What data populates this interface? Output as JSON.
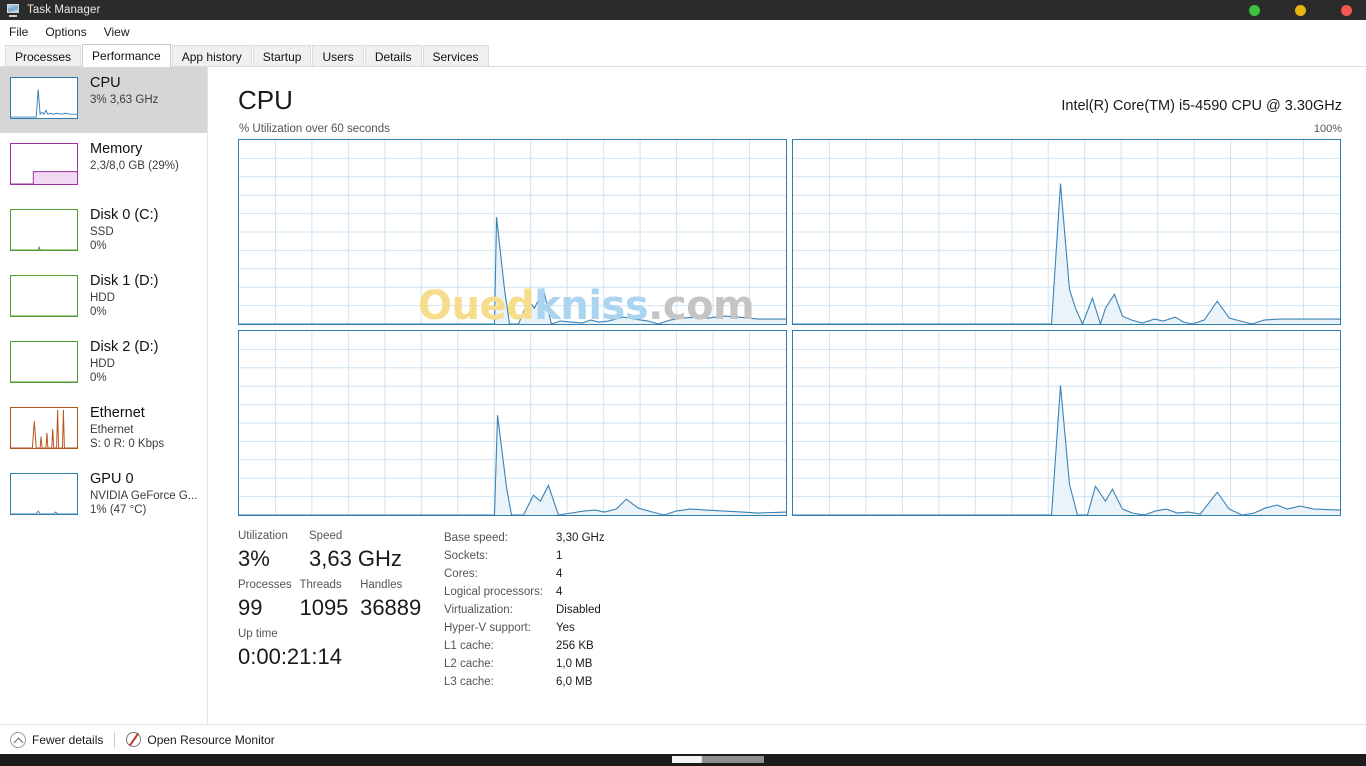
{
  "window": {
    "title": "Task Manager",
    "icon": "task-manager-icon",
    "buttons": [
      {
        "name": "minimize-button",
        "color": "#3fc23f"
      },
      {
        "name": "maximize-button",
        "color": "#e8b512"
      },
      {
        "name": "close-button",
        "color": "#f6564f"
      }
    ]
  },
  "menubar": {
    "items": [
      {
        "label": "File"
      },
      {
        "label": "Options"
      },
      {
        "label": "View"
      }
    ]
  },
  "tabs": {
    "active": "Performance",
    "items": [
      {
        "label": "Processes"
      },
      {
        "label": "Performance"
      },
      {
        "label": "App history"
      },
      {
        "label": "Startup"
      },
      {
        "label": "Users"
      },
      {
        "label": "Details"
      },
      {
        "label": "Services"
      }
    ]
  },
  "sidebar": {
    "items": [
      {
        "name": "cpu",
        "title": "CPU",
        "sub1": "3%  3,63 GHz",
        "sub2": "",
        "selected": true,
        "accent": "#2e7cb0",
        "thumb": "blue"
      },
      {
        "name": "memory",
        "title": "Memory",
        "sub1": "2,3/8,0 GB (29%)",
        "sub2": "",
        "selected": false,
        "accent": "#9c2f9c",
        "thumb": "purple"
      },
      {
        "name": "disk-0",
        "title": "Disk 0 (C:)",
        "sub1": "SSD",
        "sub2": "0%",
        "selected": false,
        "accent": "#4f9c2f",
        "thumb": "green"
      },
      {
        "name": "disk-1",
        "title": "Disk 1 (D:)",
        "sub1": "HDD",
        "sub2": "0%",
        "selected": false,
        "accent": "#4f9c2f",
        "thumb": "green"
      },
      {
        "name": "disk-2",
        "title": "Disk 2 (D:)",
        "sub1": "HDD",
        "sub2": "0%",
        "selected": false,
        "accent": "#4f9c2f",
        "thumb": "green"
      },
      {
        "name": "ethernet",
        "title": "Ethernet",
        "sub1": "Ethernet",
        "sub2": "S: 0 R: 0 Kbps",
        "selected": false,
        "accent": "#b5541c",
        "thumb": "orange"
      },
      {
        "name": "gpu-0",
        "title": "GPU 0",
        "sub1": "NVIDIA GeForce G...",
        "sub2": "1% (47 °C)",
        "selected": false,
        "accent": "#2e7cb0",
        "thumb": "blue"
      }
    ]
  },
  "main": {
    "title": "CPU",
    "cpu_name": "Intel(R) Core(TM) i5-4590 CPU @ 3.30GHz",
    "graph_label": "% Utilization over 60 seconds",
    "graph_max": "100%",
    "watermark": {
      "part1": "Oued",
      "part2": "kniss",
      "part3": ".com"
    }
  },
  "stats": {
    "left": [
      {
        "label": "Utilization",
        "value": "3%"
      },
      {
        "label": "Speed",
        "value": "3,63 GHz"
      },
      {
        "label": "Processes",
        "value": "99"
      },
      {
        "label": "Threads",
        "value": "1095"
      },
      {
        "label": "Handles",
        "value": "36889"
      },
      {
        "label": "Up time",
        "value": "0:00:21:14"
      }
    ],
    "right": [
      {
        "key": "Base speed:",
        "value": "3,30 GHz"
      },
      {
        "key": "Sockets:",
        "value": "1"
      },
      {
        "key": "Cores:",
        "value": "4"
      },
      {
        "key": "Logical processors:",
        "value": "4"
      },
      {
        "key": "Virtualization:",
        "value": "Disabled"
      },
      {
        "key": "Hyper-V support:",
        "value": "Yes"
      },
      {
        "key": "L1 cache:",
        "value": "256 KB"
      },
      {
        "key": "L2 cache:",
        "value": "1,0 MB"
      },
      {
        "key": "L3 cache:",
        "value": "6,0 MB"
      }
    ]
  },
  "statusbar": {
    "fewer_details": "Fewer details",
    "open_resource_monitor": "Open Resource Monitor"
  },
  "chart_data": {
    "type": "area",
    "title": "% Utilization over 60 seconds",
    "ylabel": "% Utilization",
    "xlabel": "60 seconds",
    "ylim": [
      0,
      100
    ],
    "grid": true,
    "legend": "none",
    "note": "Four per-logical-processor CPU utilization graphs",
    "series": [
      {
        "name": "CPU 0",
        "values": [
          0,
          0,
          0,
          0,
          0,
          0,
          0,
          0,
          0,
          0,
          0,
          0,
          0,
          0,
          0,
          0,
          0,
          0,
          0,
          0,
          0,
          0,
          0,
          0,
          0,
          0,
          0,
          0,
          0,
          0,
          0,
          0,
          0,
          0,
          0,
          0,
          0,
          0,
          0,
          0,
          0,
          0,
          0,
          0,
          0,
          0,
          0,
          0,
          0,
          0,
          0,
          0,
          58,
          38,
          2,
          0,
          8,
          14,
          5,
          2,
          18,
          6,
          4,
          4,
          3,
          4,
          3,
          5,
          4,
          4,
          3,
          6,
          9,
          10,
          7,
          4,
          2,
          1,
          2,
          5,
          7,
          5,
          4,
          6,
          8,
          8,
          6,
          4
        ]
      },
      {
        "name": "CPU 1",
        "values": [
          0,
          0,
          0,
          0,
          0,
          0,
          0,
          0,
          0,
          0,
          0,
          0,
          0,
          0,
          0,
          0,
          0,
          0,
          0,
          0,
          0,
          0,
          0,
          0,
          0,
          0,
          0,
          0,
          0,
          0,
          0,
          0,
          0,
          0,
          0,
          0,
          0,
          0,
          0,
          0,
          0,
          0,
          0,
          0,
          0,
          0,
          0,
          0,
          0,
          0,
          0,
          0,
          78,
          40,
          4,
          2,
          9,
          22,
          7,
          15,
          4,
          3,
          4,
          5,
          6,
          3,
          8,
          6,
          4,
          7,
          5,
          3,
          6,
          14,
          12,
          7,
          4,
          2,
          4,
          5,
          5,
          6,
          6,
          6,
          6,
          6,
          6,
          5
        ]
      },
      {
        "name": "CPU 2",
        "values": [
          0,
          0,
          0,
          0,
          0,
          0,
          0,
          0,
          0,
          0,
          0,
          0,
          0,
          0,
          0,
          0,
          0,
          0,
          0,
          0,
          0,
          0,
          0,
          0,
          0,
          0,
          0,
          0,
          0,
          0,
          0,
          0,
          0,
          0,
          0,
          0,
          0,
          0,
          0,
          0,
          0,
          0,
          0,
          0,
          0,
          0,
          0,
          0,
          0,
          0,
          0,
          0,
          56,
          36,
          2,
          0,
          7,
          12,
          4,
          14,
          2,
          2,
          3,
          4,
          5,
          3,
          4,
          5,
          4,
          9,
          7,
          4,
          2,
          1,
          3,
          5,
          6,
          5,
          4,
          5,
          4,
          4,
          3,
          3,
          4,
          3,
          2,
          2
        ]
      },
      {
        "name": "CPU 3",
        "values": [
          0,
          0,
          0,
          0,
          0,
          0,
          0,
          0,
          0,
          0,
          0,
          0,
          0,
          0,
          0,
          0,
          0,
          0,
          0,
          0,
          0,
          0,
          0,
          0,
          0,
          0,
          0,
          0,
          0,
          0,
          0,
          0,
          0,
          0,
          0,
          0,
          0,
          0,
          0,
          0,
          0,
          0,
          0,
          0,
          0,
          0,
          0,
          0,
          0,
          0,
          0,
          0,
          72,
          35,
          2,
          0,
          14,
          13,
          5,
          9,
          4,
          2,
          4,
          5,
          3,
          5,
          4,
          3,
          5,
          4,
          6,
          12,
          10,
          5,
          2,
          1,
          3,
          6,
          8,
          6,
          9,
          10,
          8,
          6,
          5,
          5,
          4,
          4
        ]
      }
    ]
  }
}
